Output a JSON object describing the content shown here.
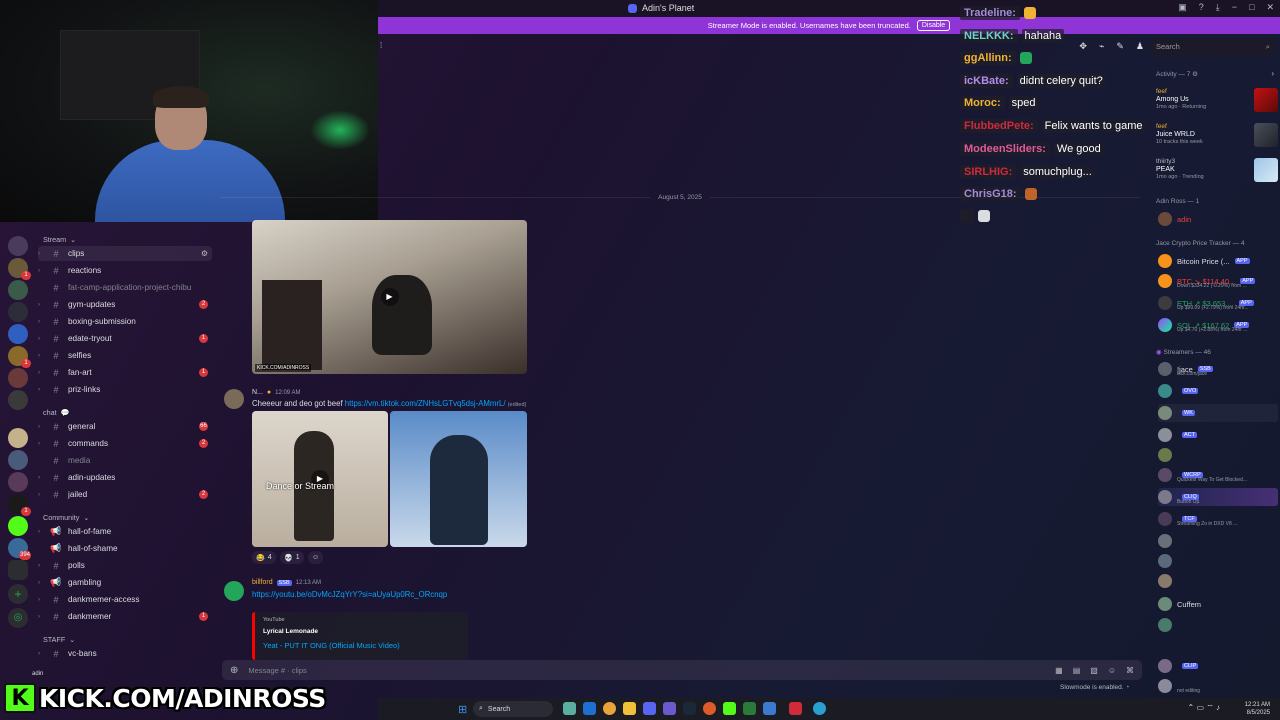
{
  "window": {
    "title": "Adin's Planet",
    "controls": [
      "−",
      "□",
      "✕"
    ]
  },
  "banner": {
    "text": "Streamer Mode is enabled. Usernames have been truncated.",
    "button": "Disable"
  },
  "search": {
    "placeholder": "Search"
  },
  "channels": {
    "categories": {
      "stream": "Stream",
      "chat": "chat",
      "community": "Community",
      "staff": "STAFF"
    },
    "items": [
      {
        "name": "clips",
        "badge": ""
      },
      {
        "name": "reactions",
        "badge": ""
      },
      {
        "name": "fat-camp-application-project-chibu",
        "badge": ""
      },
      {
        "name": "gym-updates",
        "badge": "2"
      },
      {
        "name": "boxing-submission",
        "badge": ""
      },
      {
        "name": "edate-tryout",
        "badge": "1"
      },
      {
        "name": "selfies",
        "badge": ""
      },
      {
        "name": "fan-art",
        "badge": "1"
      },
      {
        "name": "priz-links",
        "badge": ""
      },
      {
        "name": "general",
        "badge": "66"
      },
      {
        "name": "commands",
        "badge": "2"
      },
      {
        "name": "media",
        "badge": ""
      },
      {
        "name": "adin-updates",
        "badge": ""
      },
      {
        "name": "jailed",
        "badge": "2"
      },
      {
        "name": "hall-of-fame",
        "badge": ""
      },
      {
        "name": "hall-of-shame",
        "badge": ""
      },
      {
        "name": "polls",
        "badge": ""
      },
      {
        "name": "gambling",
        "badge": ""
      },
      {
        "name": "dankmemer-access",
        "badge": ""
      },
      {
        "name": "dankmemer",
        "badge": "1"
      },
      {
        "name": "vc-bans",
        "badge": ""
      }
    ],
    "user": "adin"
  },
  "servers": {
    "badges": [
      "1",
      "1",
      "1",
      "394"
    ]
  },
  "overlay": {
    "kick_logo": "K",
    "kick_text": "KICK.COM/ADINROSS"
  },
  "messages": {
    "date": "August 5, 2025",
    "m1": {
      "author": "N...",
      "time": "12:09 AM",
      "text": "Cheeeur and deo got beef",
      "link": "https://vm.tiktok.com/ZNHsLGTvq5dsj-AMmrL/",
      "edited": "(edited)",
      "caption": "Dance or Stream",
      "reactions": [
        {
          "emoji": "😂",
          "count": "4"
        },
        {
          "emoji": "💀",
          "count": "1"
        }
      ]
    },
    "m2": {
      "author": "billford",
      "tag": "SSB",
      "time": "12:13 AM",
      "link": "https://youtu.be/oDvMcJZqYrY?si=aUyaUp0Rc_ORcnqp",
      "embed": {
        "provider": "YouTube",
        "author": "Lyrical Lemonade",
        "title": "Yeat - PUT IT ONG (Official Music Video)"
      }
    },
    "watermark": "KICK.COM/ADINROSS"
  },
  "composer": {
    "placeholder": "Message # · clips",
    "slowmode": "Slowmode is enabled."
  },
  "right_panel": {
    "activity_header": "Activity — 7",
    "activities": [
      {
        "user": "feef",
        "game": "Among Us",
        "status": "1mo ago  ·  Returning"
      },
      {
        "user": "feef",
        "game": "Juice WRLD",
        "status": "10 tracks this week"
      },
      {
        "user": "thiirty3",
        "game": "PEAK",
        "status": "1mo ago  ·  Trending"
      }
    ],
    "adin_header": "Adin Ross — 1",
    "adin_member": "adin",
    "crypto_header": "Jace Crypto Price Tracker — 4",
    "crypto": [
      {
        "name": "Bitcoin Price (...",
        "sub": "",
        "color": "#dbdee1"
      },
      {
        "name": "BTC ↘ $114,40...",
        "sub": "Down $334.22 (-0.29%) from ...",
        "color": "#f23f43"
      },
      {
        "name": "ETH ↗ $3,653....",
        "sub": "Up $99.09 (+2.79%) from 24hr...",
        "color": "#23a55a"
      },
      {
        "name": "SOL ↗ $167.62",
        "sub": "Up $4.70 (+2.88%) from 24hr ...",
        "color": "#23a55a"
      }
    ],
    "app_tag": "APP",
    "streamers_header": "Streamers — 46",
    "streamers": [
      {
        "name": "!jace",
        "tag": "SSB",
        "sub": "kick.com/jace"
      },
      {
        "name": "",
        "tag": "OVO",
        "sub": ""
      },
      {
        "name": "",
        "tag": "WK",
        "sub": ""
      },
      {
        "name": "",
        "tag": "ACT",
        "sub": ""
      },
      {
        "name": "",
        "tag": "",
        "sub": ""
      },
      {
        "name": "",
        "tag": "WCRP",
        "sub": "Quickest Way To Get Blocked..."
      },
      {
        "name": "",
        "tag": "CLIQ",
        "sub": "Button Up."
      },
      {
        "name": "",
        "tag": "TCF",
        "sub": "Streaming Zo in DXD V8 ..."
      },
      {
        "name": "",
        "tag": "",
        "sub": ""
      },
      {
        "name": "",
        "tag": "",
        "sub": ""
      },
      {
        "name": "",
        "tag": "",
        "sub": ""
      },
      {
        "name": "Cuffem",
        "tag": "",
        "sub": ""
      },
      {
        "name": "",
        "tag": "",
        "sub": ""
      },
      {
        "name": "",
        "tag": "CLIP",
        "sub": ""
      },
      {
        "name": "",
        "tag": "",
        "sub": "not editing"
      }
    ]
  },
  "stream_chat": [
    {
      "user": "Tradeline:",
      "msg": "",
      "color": "#a58bd9"
    },
    {
      "user": "NELKKK:",
      "msg": "hahaha",
      "color": "#6fd3c8"
    },
    {
      "user": "ggAllinn:",
      "msg": "",
      "color": "#f0b232"
    },
    {
      "user": "icKBate:",
      "msg": "didnt celery quit?",
      "color": "#b18cf0"
    },
    {
      "user": "Moroc:",
      "msg": "sped",
      "color": "#f0b232"
    },
    {
      "user": "FlubbedPete:",
      "msg": "Felix wants to game",
      "color": "#d12a3a"
    },
    {
      "user": "ModeenSliders:",
      "msg": "We good",
      "color": "#e05b9a"
    },
    {
      "user": "SIRLHIG:",
      "msg": "somuchplug...",
      "color": "#d12a3a"
    },
    {
      "user": "ChrisG18:",
      "msg": "",
      "color": "#a58bd9"
    },
    {
      "user": "",
      "msg": "",
      "color": "#d12a3a"
    }
  ],
  "taskbar": {
    "search": "Search",
    "time": "12:21 AM",
    "date": "8/5/2025"
  }
}
